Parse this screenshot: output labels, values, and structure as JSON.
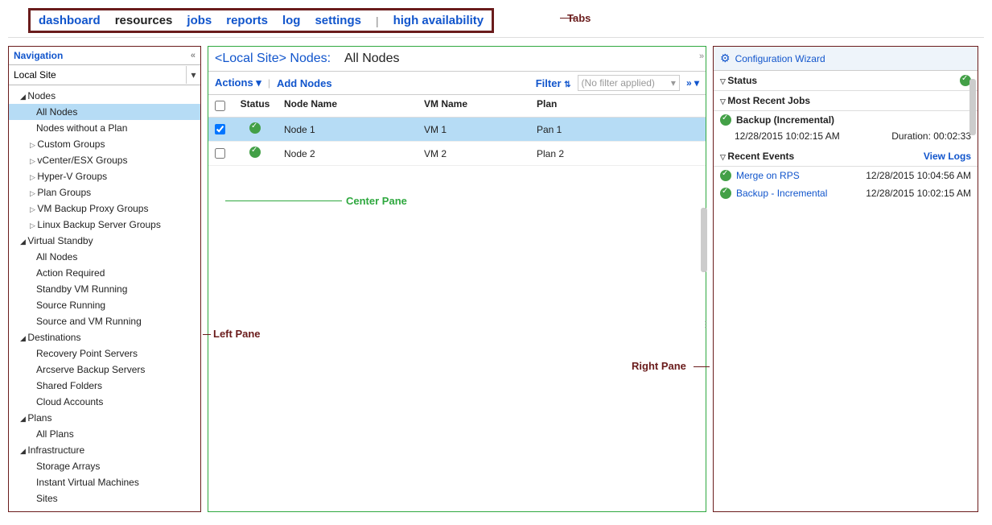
{
  "annotations": {
    "tabs": "Tabs",
    "left": "Left Pane",
    "center": "Center Pane",
    "right": "Right Pane"
  },
  "tabs": [
    {
      "label": "dashboard",
      "active": false
    },
    {
      "label": "resources",
      "active": true
    },
    {
      "label": "jobs",
      "active": false
    },
    {
      "label": "reports",
      "active": false
    },
    {
      "label": "log",
      "active": false
    },
    {
      "label": "settings",
      "active": false
    },
    {
      "sep": "|"
    },
    {
      "label": "high availability",
      "active": false
    }
  ],
  "nav": {
    "title": "Navigation",
    "site": "Local Site",
    "tree": [
      {
        "type": "root",
        "label": "Nodes"
      },
      {
        "type": "leaf",
        "label": "All Nodes",
        "selected": true
      },
      {
        "type": "leaf",
        "label": "Nodes without a Plan"
      },
      {
        "type": "exp",
        "label": "Custom Groups"
      },
      {
        "type": "exp",
        "label": "vCenter/ESX Groups"
      },
      {
        "type": "exp",
        "label": "Hyper-V Groups"
      },
      {
        "type": "exp",
        "label": "Plan Groups"
      },
      {
        "type": "exp",
        "label": "VM Backup Proxy Groups"
      },
      {
        "type": "exp",
        "label": "Linux Backup Server Groups"
      },
      {
        "type": "root",
        "label": "Virtual Standby"
      },
      {
        "type": "leaf",
        "label": "All Nodes"
      },
      {
        "type": "leaf",
        "label": "Action Required"
      },
      {
        "type": "leaf",
        "label": "Standby VM Running"
      },
      {
        "type": "leaf",
        "label": "Source Running"
      },
      {
        "type": "leaf",
        "label": "Source and VM Running"
      },
      {
        "type": "root",
        "label": "Destinations"
      },
      {
        "type": "leaf",
        "label": "Recovery Point Servers"
      },
      {
        "type": "leaf",
        "label": "Arcserve Backup Servers"
      },
      {
        "type": "leaf",
        "label": "Shared Folders"
      },
      {
        "type": "leaf",
        "label": "Cloud Accounts"
      },
      {
        "type": "root",
        "label": "Plans"
      },
      {
        "type": "leaf",
        "label": "All Plans"
      },
      {
        "type": "root",
        "label": "Infrastructure"
      },
      {
        "type": "leaf",
        "label": "Storage Arrays"
      },
      {
        "type": "leaf",
        "label": "Instant Virtual Machines"
      },
      {
        "type": "leaf",
        "label": "Sites"
      }
    ]
  },
  "center": {
    "title_prefix": "<Local Site> Nodes:",
    "title_current": "All Nodes",
    "actions": "Actions",
    "add_nodes": "Add Nodes",
    "filter": "Filter",
    "filter_placeholder": "(No filter applied)",
    "more": "»",
    "columns": {
      "status": "Status",
      "node": "Node Name",
      "vm": "VM Name",
      "plan": "Plan"
    },
    "rows": [
      {
        "checked": true,
        "selected": true,
        "node": "Node 1",
        "vm": "VM 1",
        "plan": "Pan 1"
      },
      {
        "checked": false,
        "selected": false,
        "node": "Node 2",
        "vm": "VM 2",
        "plan": "Plan 2"
      }
    ]
  },
  "right": {
    "config": "Configuration Wizard",
    "status": "Status",
    "jobs": "Most Recent Jobs",
    "job": {
      "name": "Backup (Incremental)",
      "time": "12/28/2015 10:02:15 AM",
      "dur_label": "Duration:",
      "dur": "00:02:33"
    },
    "events": "Recent Events",
    "view_logs": "View Logs",
    "event_rows": [
      {
        "name": "Merge on RPS",
        "time": "12/28/2015 10:04:56 AM"
      },
      {
        "name": "Backup - Incremental",
        "time": "12/28/2015 10:02:15 AM"
      }
    ]
  }
}
